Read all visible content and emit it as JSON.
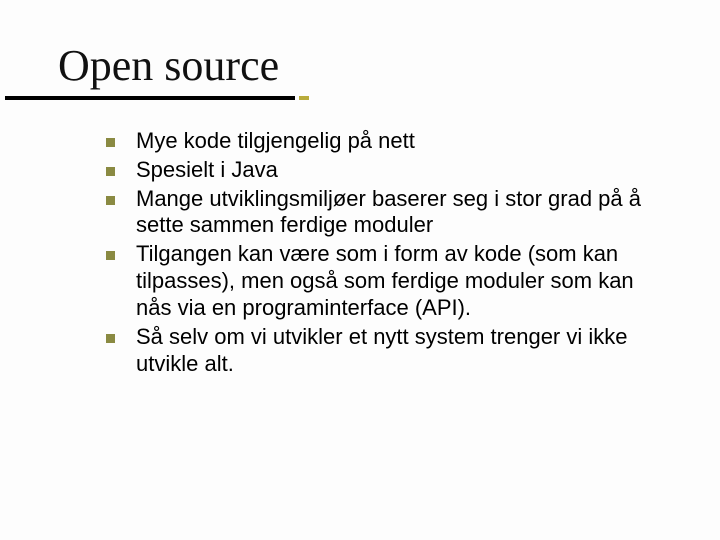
{
  "slide": {
    "title": "Open source",
    "bullets": [
      "Mye kode tilgjengelig på nett",
      "Spesielt i Java",
      "Mange utviklingsmiljøer baserer seg i stor grad på å sette sammen ferdige moduler",
      "Tilgangen kan være som i form av kode (som kan tilpasses), men også som ferdige moduler som kan nås via en programinterface (API).",
      "Så selv om vi utvikler et nytt system trenger vi ikke utvikle alt."
    ]
  }
}
